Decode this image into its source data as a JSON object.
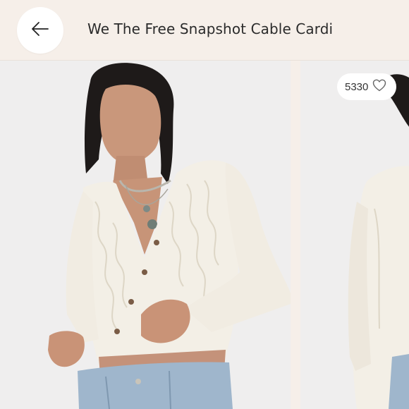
{
  "header": {
    "title": "We The Free Snapshot Cable Cardi",
    "back_icon": "arrow-left-icon"
  },
  "listing": {
    "like_count": "5330",
    "like_icon": "heart-outline-icon"
  },
  "colors": {
    "background": "#f6efe9",
    "photo_bg": "#efeeee",
    "sweater": "#f3efe6",
    "denim": "#9fb6cc"
  }
}
